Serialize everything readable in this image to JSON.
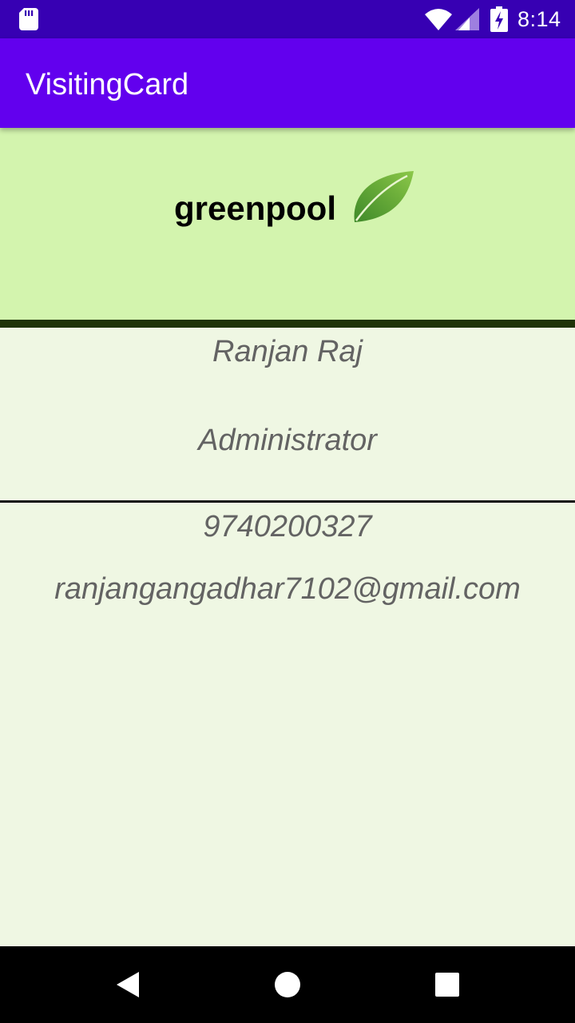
{
  "status_bar": {
    "time": "8:14",
    "icons": [
      "sd-card-icon",
      "wifi-icon",
      "cell-signal-icon",
      "battery-charging-icon"
    ]
  },
  "app_bar": {
    "title": "VisitingCard"
  },
  "header": {
    "brand": "greenpool",
    "logo_icon": "leaf-icon"
  },
  "card": {
    "name": "Ranjan Raj",
    "role": "Administrator",
    "phone": "9740200327",
    "email": "ranjangangadhar7102@gmail.com"
  },
  "nav_bar": {
    "buttons": [
      "back-icon",
      "home-icon",
      "recents-icon"
    ]
  },
  "colors": {
    "status_bar": "#3700b3",
    "app_bar": "#6200ee",
    "header_bg": "#d3f4ae",
    "body_bg": "#eff7e3",
    "divider": "#1f3308",
    "text_muted": "#636363"
  }
}
